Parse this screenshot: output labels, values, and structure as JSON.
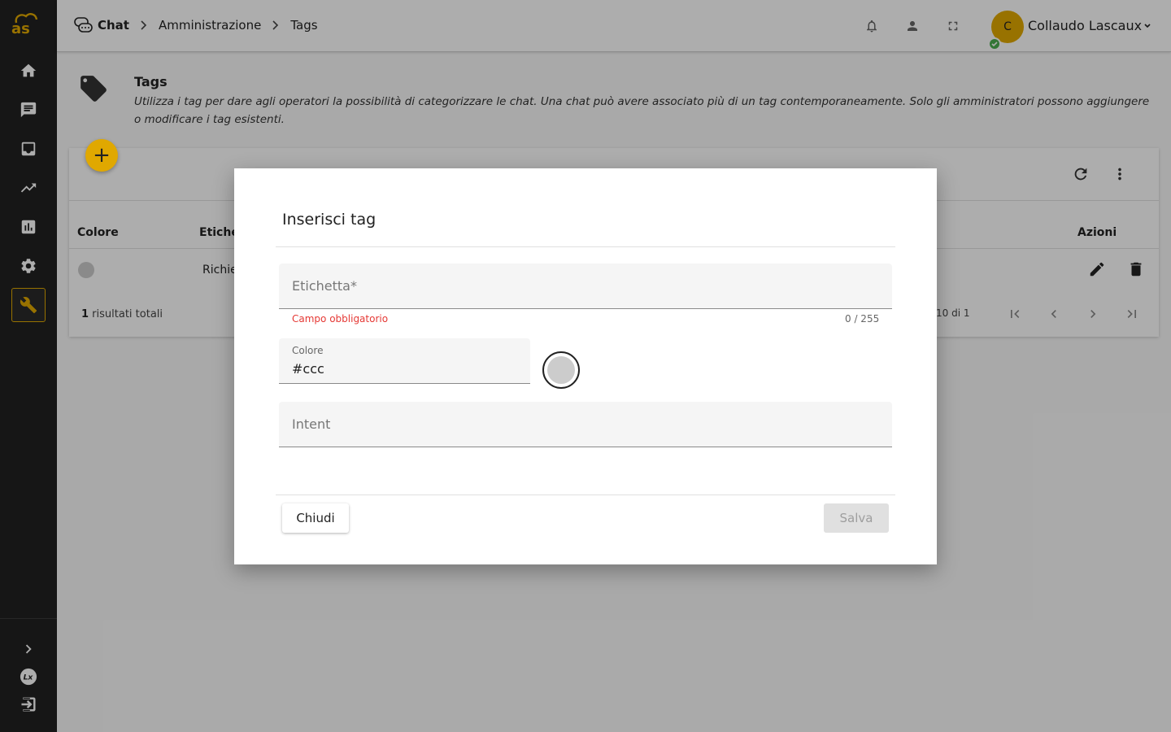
{
  "breadcrumb": [
    "Chat",
    "Amministrazione",
    "Tags"
  ],
  "user": {
    "initial": "C",
    "name": "Collaudo Lascaux"
  },
  "page": {
    "title": "Tags",
    "description": "Utilizza i tag per dare agli operatori la possibilità di categorizzare le chat. Una chat può avere associato più di un tag contemporaneamente. Solo gli amministratori possono aggiungere o modificare i tag esistenti."
  },
  "table": {
    "headers": {
      "color": "Colore",
      "label": "Etichet",
      "actions": "Azioni"
    },
    "rows": [
      {
        "label": "Richie",
        "color": "#cccccc"
      }
    ],
    "total_count": "1",
    "total_suffix": " risultati totali",
    "pager_range": "10 di 1"
  },
  "dialog": {
    "title": "Inserisci tag",
    "label_placeholder": "Etichetta*",
    "label_error": "Campo obbligatorio",
    "label_counter": "0 / 255",
    "color_label": "Colore",
    "color_value": "#ccc",
    "intent_placeholder": "Intent",
    "close_label": "Chiudi",
    "save_label": "Salva"
  },
  "colors": {
    "accent": "#e0a800",
    "sidebar": "#212121",
    "error": "#e53935",
    "status": "#4caf50"
  }
}
